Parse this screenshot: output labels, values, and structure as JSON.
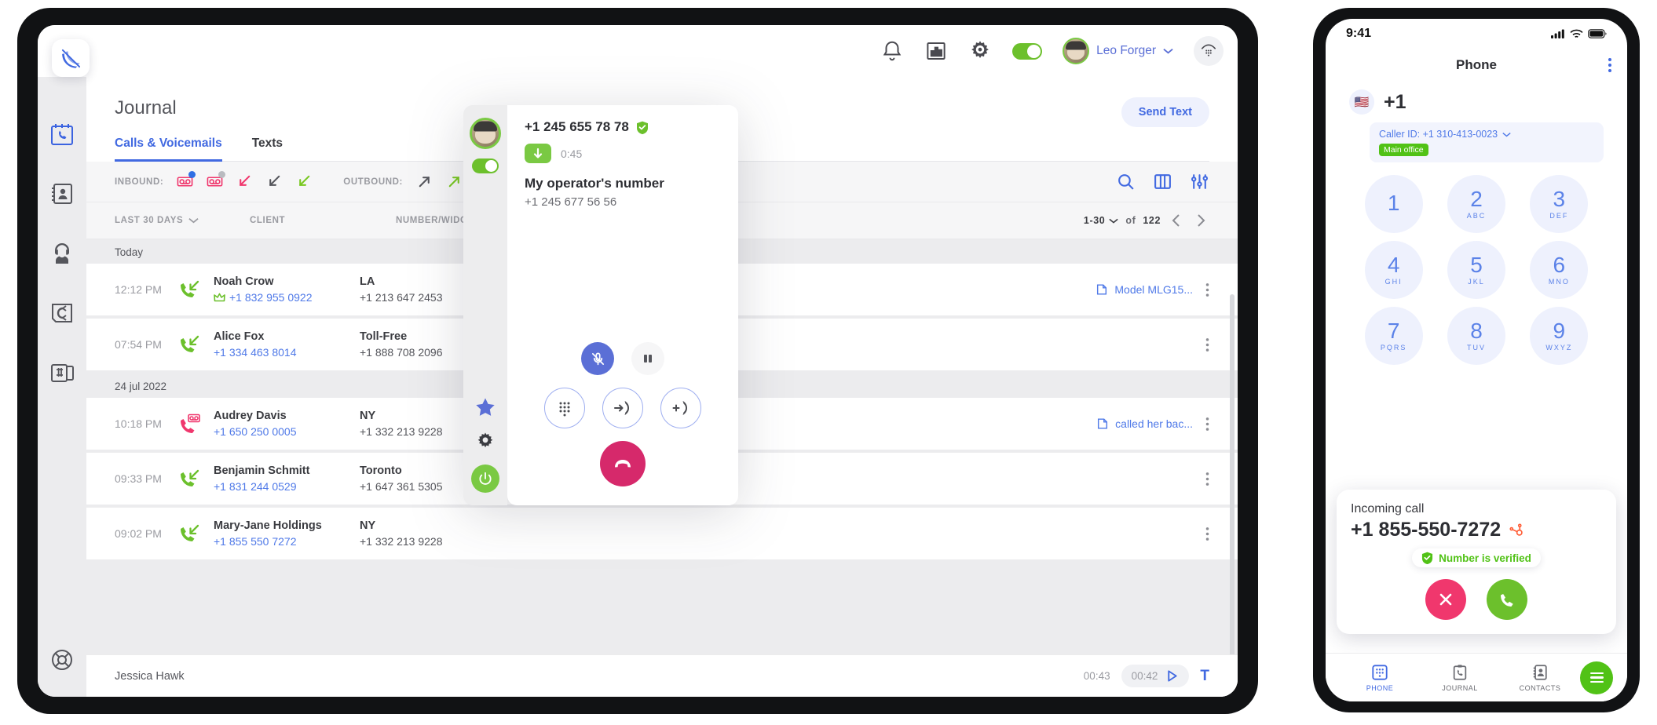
{
  "tablet": {
    "header": {
      "notifications_icon": "bell-icon",
      "analytics_icon": "chart-icon",
      "settings_icon": "gear-icon",
      "status_toggle": "online",
      "username": "Leo Forger",
      "dialpad_icon": "dialpad-icon"
    },
    "rail": [
      {
        "name": "journal",
        "icon": "calendar-phone-icon",
        "active": true
      },
      {
        "name": "contacts",
        "icon": "address-book-icon",
        "active": false
      },
      {
        "name": "operators",
        "icon": "headset-agent-icon",
        "active": false
      },
      {
        "name": "call-flows",
        "icon": "call-flow-icon",
        "active": false
      },
      {
        "name": "numbers",
        "icon": "hash-device-icon",
        "active": false
      },
      {
        "name": "help",
        "icon": "lifebuoy-icon",
        "active": false
      }
    ],
    "page_title": "Journal",
    "tabs": [
      {
        "label": "Calls & Voicemails",
        "active": true
      },
      {
        "label": "Texts",
        "active": false
      }
    ],
    "send_text_label": "Send Text",
    "filters": {
      "inbound_label": "INBOUND:",
      "outbound_label": "OUTBOUND:",
      "inbound_icons": [
        {
          "name": "voicemail-new-icon",
          "dot": "#2f6fe4"
        },
        {
          "name": "voicemail-heard-icon",
          "dot": "#b9bbc0"
        },
        {
          "name": "missed-call-icon",
          "dot": ""
        },
        {
          "name": "declined-call-icon",
          "dot": ""
        },
        {
          "name": "answered-call-icon",
          "dot": ""
        }
      ],
      "outbound_icons": [
        {
          "name": "outbound-unanswered-icon"
        },
        {
          "name": "outbound-answered-icon"
        }
      ],
      "tools": [
        {
          "name": "search-icon"
        },
        {
          "name": "columns-icon"
        },
        {
          "name": "sliders-icon"
        }
      ]
    },
    "table": {
      "columns": {
        "time": "LAST 30 DAYS",
        "client": "CLIENT",
        "number_widget": "NUMBER/WIDGET"
      },
      "pagination": {
        "range": "1-30",
        "of_label": "of",
        "total": "122"
      },
      "groups": [
        {
          "day": "Today",
          "rows": [
            {
              "time": "12:12 PM",
              "call_icon": "answered-inbound-call-icon",
              "name": "Noah Crow",
              "number": "+1 832 955 0922",
              "vip": true,
              "widget_name": "LA",
              "widget_number": "+1 213 647 2453",
              "note": "Model MLG15...",
              "has_note": true
            },
            {
              "time": "07:54 PM",
              "call_icon": "answered-inbound-call-icon",
              "name": "Alice Fox",
              "number": "+1 334 463 8014",
              "vip": false,
              "widget_name": "Toll-Free",
              "widget_number": "+1 888 708 2096",
              "note": "",
              "has_note": false
            }
          ]
        },
        {
          "day": "24 jul 2022",
          "rows": [
            {
              "time": "10:18 PM",
              "call_icon": "voicemail-inbound-icon",
              "name": "Audrey Davis",
              "number": "+1 650 250 0005",
              "vip": false,
              "widget_name": "NY",
              "widget_number": "+1 332 213 9228",
              "note": "called her bac...",
              "has_note": true
            },
            {
              "time": "09:33 PM",
              "call_icon": "answered-inbound-call-icon",
              "name": "Benjamin Schmitt",
              "number": "+1 831 244 0529",
              "vip": false,
              "widget_name": "Toronto",
              "widget_number": "+1 647 361 5305",
              "note": "",
              "has_note": false
            },
            {
              "time": "09:02 PM",
              "call_icon": "answered-inbound-call-icon",
              "name": "Mary-Jane Holdings",
              "number": "+1 855 550 7272",
              "vip": false,
              "widget_name": "NY",
              "widget_number": "+1 332 213 9228",
              "note": "",
              "has_note": false
            }
          ]
        }
      ]
    },
    "player": {
      "name": "Jessica Hawk",
      "total": "00:43",
      "current": "00:42",
      "play_icon": "play-icon",
      "transcript_label": "T"
    }
  },
  "call_popup": {
    "number": "+1 245 655 78 78",
    "verified_icon": "shield-check-icon",
    "direction_icon": "arrow-down-icon",
    "duration": "0:45",
    "operator_label": "My operator's number",
    "operator_number": "+1 245 677 56 56",
    "rail": {
      "favorite_icon": "star-icon",
      "settings_icon": "gear-icon",
      "power_icon": "power-icon"
    },
    "controls": {
      "mute_icon": "mic-off-icon",
      "pause_icon": "pause-icon",
      "dialpad_icon": "dialpad-icon",
      "transfer_icon": "transfer-call-icon",
      "add_call_icon": "add-call-icon",
      "hangup_icon": "hangup-icon"
    }
  },
  "phone": {
    "status_bar": {
      "time": "9:41",
      "signal_icon": "cellular-signal-icon",
      "wifi_icon": "wifi-icon",
      "battery_icon": "battery-full-icon"
    },
    "title": "Phone",
    "menu_icon": "kebab-menu-icon",
    "country_flag": "🇺🇸",
    "country_code": "+1",
    "caller_id_label": "Caller ID: +1 310-413-0023",
    "office_badge": "Main office",
    "keys": [
      {
        "digit": "1",
        "letters": ""
      },
      {
        "digit": "2",
        "letters": "ABC"
      },
      {
        "digit": "3",
        "letters": "DEF"
      },
      {
        "digit": "4",
        "letters": "GHI"
      },
      {
        "digit": "5",
        "letters": "JKL"
      },
      {
        "digit": "6",
        "letters": "MNO"
      },
      {
        "digit": "7",
        "letters": "PQRS"
      },
      {
        "digit": "8",
        "letters": "TUV"
      },
      {
        "digit": "9",
        "letters": "WXYZ"
      }
    ],
    "incoming": {
      "label": "Incoming call",
      "number": "+1 855-550-7272",
      "crm_icon": "hubspot-icon",
      "verified_text": "Number is verified",
      "verified_icon": "shield-check-icon",
      "decline_icon": "close-icon",
      "accept_icon": "phone-icon"
    },
    "nav": [
      {
        "label": "PHONE",
        "icon": "dialpad-icon",
        "active": true
      },
      {
        "label": "JOURNAL",
        "icon": "clipboard-phone-icon",
        "active": false
      },
      {
        "label": "CONTACTS",
        "icon": "address-book-icon",
        "active": false
      }
    ],
    "fab_icon": "menu-icon"
  },
  "colors": {
    "accent": "#4169e1",
    "green": "#6cc02c",
    "pink": "#f0376d",
    "hangup": "#d6296b"
  }
}
